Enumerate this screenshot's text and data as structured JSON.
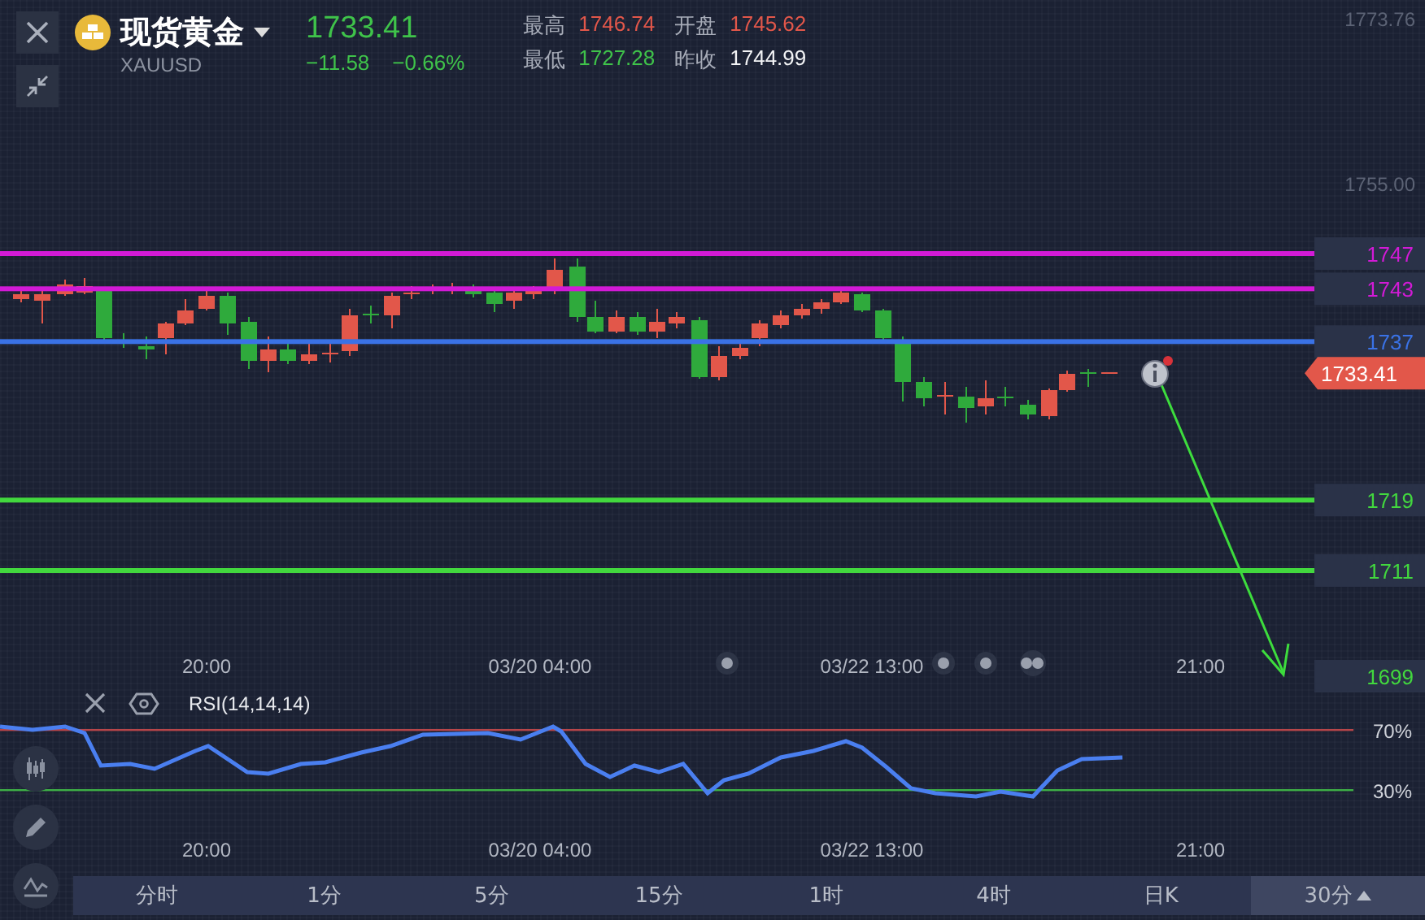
{
  "header": {
    "name": "现货黄金",
    "code": "XAUUSD",
    "price": "1733.41",
    "change": "−11.58",
    "change_pct": "−0.66%",
    "stats": [
      {
        "label": "最高",
        "value": "1746.74",
        "kind": "up"
      },
      {
        "label": "开盘",
        "value": "1745.62",
        "kind": "up"
      },
      {
        "label": "最低",
        "value": "1727.28",
        "kind": "down"
      },
      {
        "label": "昨收",
        "value": "1744.99",
        "kind": "neutral"
      }
    ]
  },
  "price_axis": [
    "1773.76",
    "1755.00"
  ],
  "levels": [
    {
      "label": "1747",
      "color": "#d21ad6",
      "line": true
    },
    {
      "label": "1743",
      "color": "#d21ad6",
      "line": true
    },
    {
      "label": "1737",
      "color": "#3a72e6",
      "line": true
    },
    {
      "label": "1719",
      "color": "#42d83e",
      "line": true
    },
    {
      "label": "1711",
      "color": "#42d83e",
      "line": true
    },
    {
      "label": "1699",
      "color": "#42d83e",
      "line": false
    }
  ],
  "current_price_tag": "1733.41",
  "time_axis": [
    "20:00",
    "03/20 04:00",
    "03/22 13:00",
    "21:00"
  ],
  "rsi": {
    "title": "RSI(14,14,14)",
    "lines": [
      {
        "label": "70%",
        "color": "#b8464a"
      },
      {
        "label": "30%",
        "color": "#3daf46"
      }
    ],
    "time_axis": [
      "20:00",
      "03/20 04:00",
      "03/22 13:00",
      "21:00"
    ]
  },
  "timeframes": [
    {
      "label": "分时",
      "selected": false
    },
    {
      "label": "1分",
      "selected": false
    },
    {
      "label": "5分",
      "selected": false
    },
    {
      "label": "15分",
      "selected": false
    },
    {
      "label": "1时",
      "selected": false
    },
    {
      "label": "4时",
      "selected": false
    },
    {
      "label": "日K",
      "selected": false
    },
    {
      "label": "30分",
      "selected": true
    }
  ]
}
